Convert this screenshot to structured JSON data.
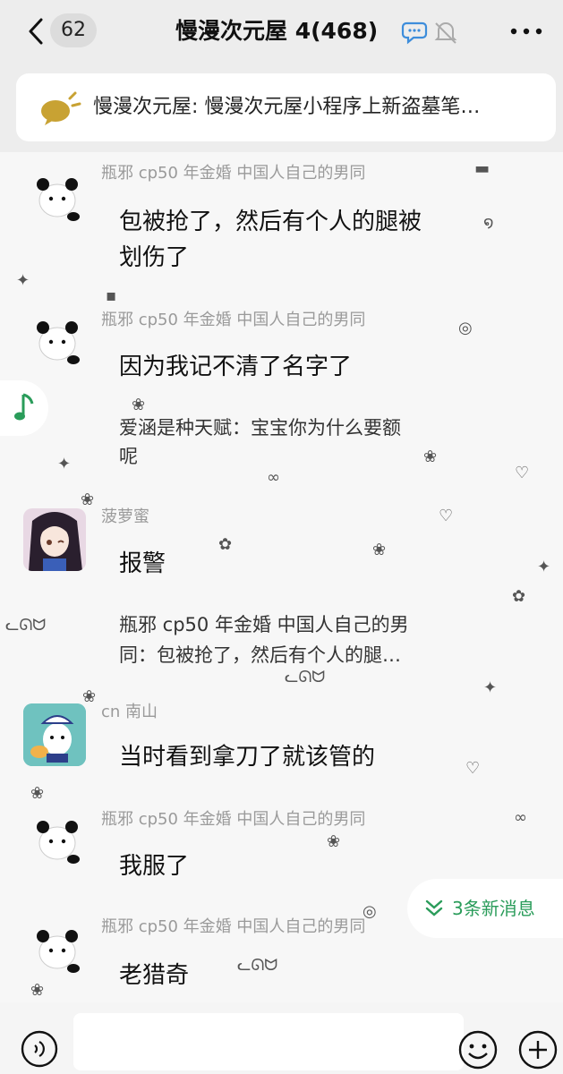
{
  "header": {
    "back_icon": "chevron-left-icon",
    "unread_count": "62",
    "title": "慢漫次元屋 4(468)",
    "icons": [
      "chat-bubble-icon",
      "mute-bell-icon",
      "more-dots-icon"
    ]
  },
  "notice": {
    "icon": "megaphone-icon",
    "text": "慢漫次元屋: 慢漫次元屋小程序上新盗墓笔…"
  },
  "messages": [
    {
      "sender": "瓶邪 cp50 年金婚 中国人自己的男同",
      "lines": [
        "包被抢了，然后有个人的腿被",
        "划伤了"
      ]
    },
    {
      "sender": "瓶邪 cp50 年金婚 中国人自己的男同",
      "lines": [
        "因为我记不清了名字了"
      ],
      "quote": [
        "爱涵是种天赋：宝宝你为什么要额",
        "呢"
      ]
    },
    {
      "sender": "菠萝蜜",
      "lines": [
        "报警"
      ],
      "quote": [
        "瓶邪 cp50 年金婚 中国人自己的男",
        "同：包被抢了，然后有个人的腿…"
      ]
    },
    {
      "sender": "cn 南山",
      "lines": [
        "当时看到拿刀了就该管的"
      ]
    },
    {
      "sender": "瓶邪 cp50 年金婚 中国人自己的男同",
      "lines": [
        "我服了"
      ]
    },
    {
      "sender": "瓶邪 cp50 年金婚 中国人自己的男同",
      "lines": [
        "老猎奇"
      ]
    }
  ],
  "new_messages": {
    "icon": "double-chevron-down-icon",
    "label": "3条新消息"
  },
  "input_bar": {
    "voice_icon": "voice-icon",
    "input_value": "",
    "emoji_icon": "emoji-icon",
    "plus_icon": "plus-icon"
  },
  "colors": {
    "accent": "#2a9c5a",
    "background": "#ededed",
    "bubble": "#ffffff"
  }
}
